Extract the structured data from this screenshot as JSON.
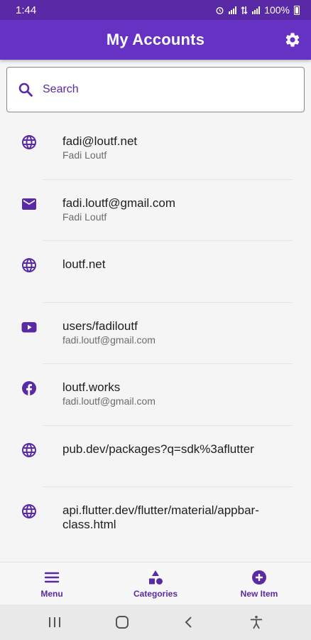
{
  "status": {
    "time": "1:44",
    "battery": "100%"
  },
  "appbar": {
    "title": "My Accounts",
    "settings_icon": "gear-icon"
  },
  "search": {
    "placeholder": "Search"
  },
  "accounts": [
    {
      "icon": "globe-icon",
      "title": "fadi@loutf.net",
      "subtitle": "Fadi Loutf"
    },
    {
      "icon": "mail-icon",
      "title": "fadi.loutf@gmail.com",
      "subtitle": "Fadi Loutf"
    },
    {
      "icon": "globe-icon",
      "title": "loutf.net",
      "subtitle": ""
    },
    {
      "icon": "youtube-icon",
      "title": "users/fadiloutf",
      "subtitle": "fadi.loutf@gmail.com"
    },
    {
      "icon": "facebook-icon",
      "title": "loutf.works",
      "subtitle": "fadi.loutf@gmail.com"
    },
    {
      "icon": "globe-icon",
      "title": "pub.dev/packages?q=sdk%3aflutter",
      "subtitle": ""
    },
    {
      "icon": "globe-icon",
      "title": "api.flutter.dev/flutter/material/appbar-class.html",
      "subtitle": ""
    }
  ],
  "bottom_nav": [
    {
      "icon": "menu-icon",
      "label": "Menu"
    },
    {
      "icon": "categories-icon",
      "label": "Categories"
    },
    {
      "icon": "add-circle-icon",
      "label": "New Item"
    }
  ],
  "colors": {
    "primary": "#6632c4",
    "status_bar": "#5a2aa6",
    "accent": "#5a2aa6"
  }
}
